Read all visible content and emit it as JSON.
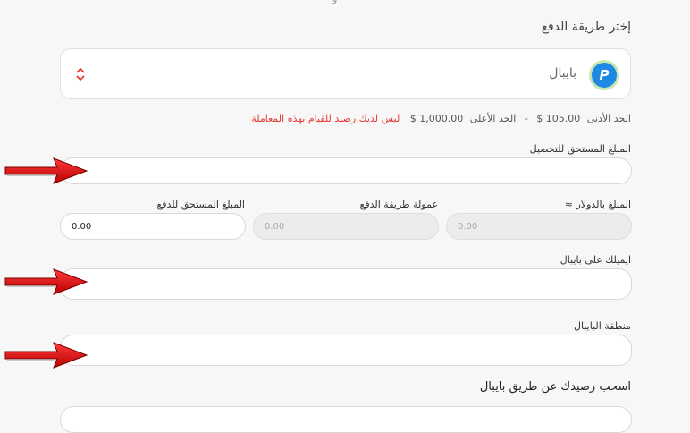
{
  "top_fragment": "و",
  "payment_section": {
    "title": "إختر طريقة الدفع",
    "selected_method": "بايبال",
    "icon": "paypal-logo",
    "select_chevron_color": "#e53935"
  },
  "limits": {
    "min_label": "الحد الأدنى",
    "min_value": "105.00 $",
    "separator": "-",
    "max_label": "الحد الأعلى",
    "max_value": "1,000.00 $",
    "warning": "ليس لديك رصيد للقيام بهذه المعاملة",
    "warning_color": "#e53935"
  },
  "fields": {
    "amount_due_label": "المبلغ المستحق للتحصيل",
    "amount_usd_label": "المبلغ بالدولار ≈",
    "amount_usd_value": "0.00",
    "fee_label": "عمولة طريقة الدفع",
    "fee_value": "0.00",
    "payable_label": "المبلغ المستحق للدفع",
    "payable_value": "0.00",
    "paypal_email_label": "ايميلك على بايبال",
    "paypal_region_label": "منطقة البايبال"
  },
  "withdraw_section": {
    "title": "اسحب رصيدك عن طريق بايبال"
  },
  "annotations": {
    "arrow_color": "#e0141e",
    "arrow_count": 3
  }
}
